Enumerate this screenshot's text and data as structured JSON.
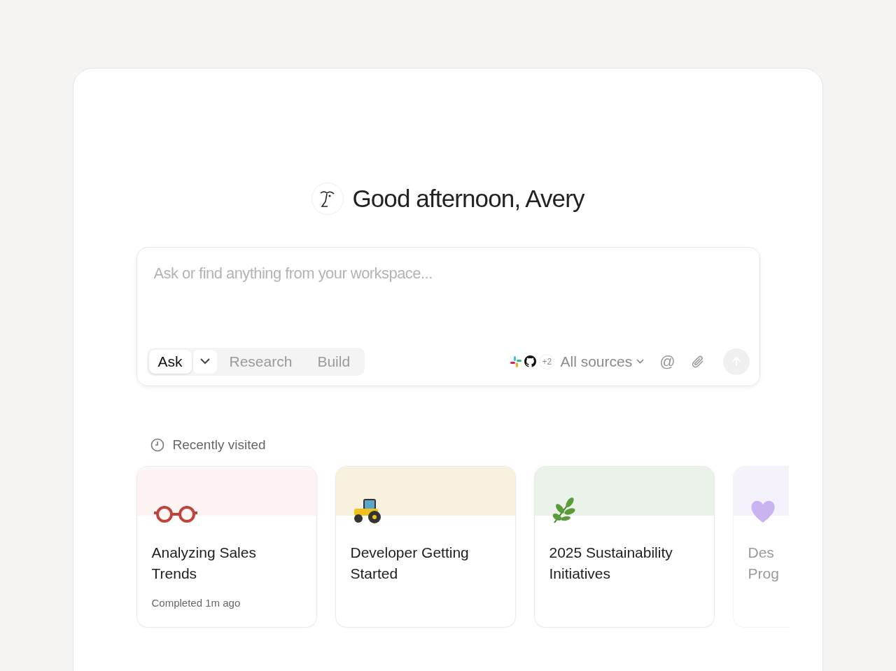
{
  "greeting": "Good afternoon, Avery",
  "prompt": {
    "placeholder": "Ask or find anything from your workspace...",
    "modes": [
      {
        "label": "Ask",
        "selected": true
      },
      {
        "label": "Research",
        "selected": false
      },
      {
        "label": "Build",
        "selected": false
      }
    ],
    "sources_extra": "+2",
    "sources_label": "All sources",
    "mention": "@"
  },
  "recent": {
    "title": "Recently visited",
    "cards": [
      {
        "kind": "glasses",
        "color": "#fdf4f3",
        "title": "Analyzing Sales Trends",
        "subtitle": "Completed 1m ago",
        "faded": false
      },
      {
        "kind": "tractor",
        "color": "#f9f1e0",
        "title": "Developer Getting Started",
        "faded": false
      },
      {
        "kind": "leaf",
        "color": "#ebf2ea",
        "title": "2025 Sustainability Initiatives",
        "faded": false
      },
      {
        "kind": "heart",
        "color": "#f6f2fb",
        "title": "Des Prog",
        "faded": true
      }
    ]
  }
}
